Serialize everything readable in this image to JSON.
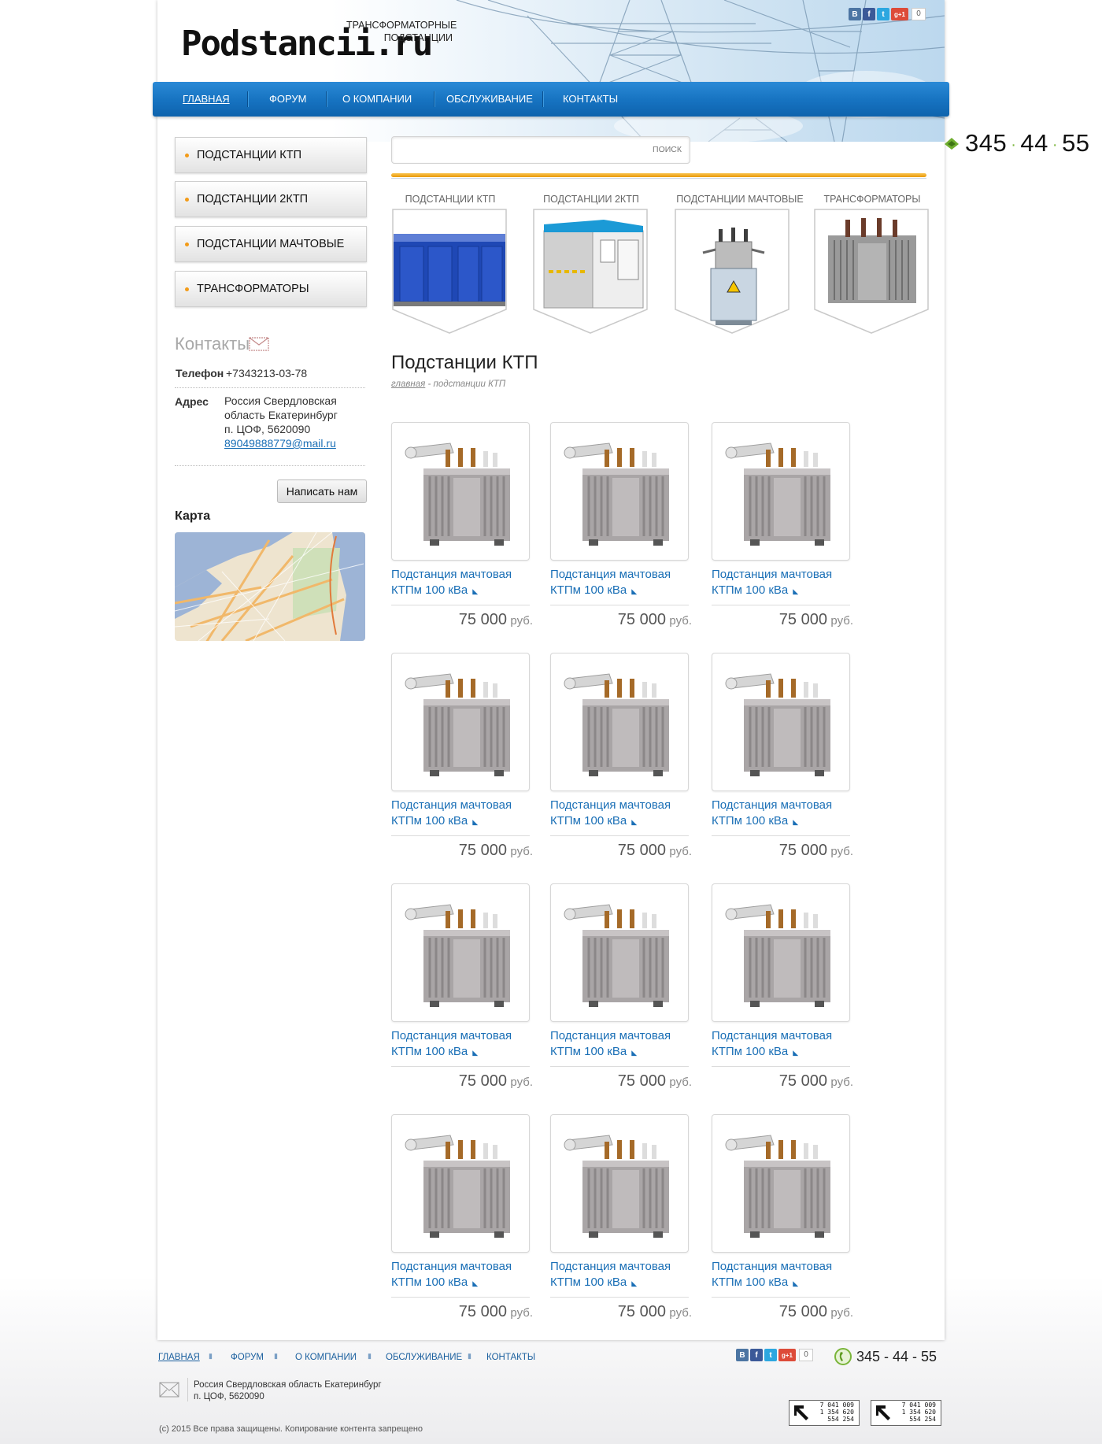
{
  "site": {
    "logo": "Podstancii.ru",
    "tagline_line1": "ТРАНСФОРМАТОРНЫЕ",
    "tagline_line2": "ПОДСТАНЦИИ"
  },
  "social": {
    "buttons": [
      {
        "icon": "vk-icon",
        "glyph": "В",
        "color": "#4c75a3"
      },
      {
        "icon": "facebook-icon",
        "glyph": "f",
        "color": "#3b5998"
      },
      {
        "icon": "twitter-icon",
        "glyph": "t",
        "color": "#2ca7e0"
      },
      {
        "icon": "google-plus-icon",
        "glyph": "g+1",
        "color": "#dd4b39"
      }
    ],
    "count": "0"
  },
  "nav": {
    "items": [
      "ГЛАВНАЯ",
      "ФОРУМ",
      "О КОМПАНИИ",
      "ОБСЛУЖИВАНИЕ",
      "КОНТАКТЫ"
    ],
    "active": "ГЛАВНАЯ"
  },
  "search": {
    "placeholder": "",
    "button": "ПОИСК"
  },
  "phone": {
    "part1": "345",
    "part2": "44",
    "part3": "55"
  },
  "sidebar": {
    "menu": [
      "ПОДСТАНЦИИ КТП",
      "ПОДСТАНЦИИ 2КТП",
      "ПОДСТАНЦИИ МАЧТОВЫЕ",
      "ТРАНСФОРМАТОРЫ"
    ],
    "contacts_title": "Контакты",
    "phone_label": "Телефон",
    "phone_value": "+7343213-03-78",
    "address_label": "Адрес",
    "address_line1": "Россия Свердловская",
    "address_line2": "область Екатеринбург",
    "address_line3": "п. ЦОФ, 5620090",
    "email": "89049888779@mail.ru",
    "write_button": "Написать нам",
    "map_title": "Карта"
  },
  "categories": [
    {
      "label": "ПОДСТАНЦИИ КТП",
      "icon": "ktp-substation-image"
    },
    {
      "label": "ПОДСТАНЦИИ 2КТП",
      "icon": "2ktp-substation-image"
    },
    {
      "label": "ПОДСТАНЦИИ МАЧТОВЫЕ",
      "icon": "mast-substation-image"
    },
    {
      "label": "ТРАНСФОРМАТОРЫ",
      "icon": "transformer-image"
    }
  ],
  "content": {
    "title": "Подстанции КТП",
    "breadcrumb_home": "главная",
    "breadcrumb_sep": " - ",
    "breadcrumb_current": "подстанции КТП"
  },
  "products": [
    {
      "name_line1": "Подстанция мачтовая",
      "name_line2": "КТПм 100 кВа",
      "price": "75 000",
      "currency": "руб."
    },
    {
      "name_line1": "Подстанция мачтовая",
      "name_line2": "КТПм 100 кВа",
      "price": "75 000",
      "currency": "руб."
    },
    {
      "name_line1": "Подстанция мачтовая",
      "name_line2": "КТПм 100 кВа",
      "price": "75 000",
      "currency": "руб."
    },
    {
      "name_line1": "Подстанция мачтовая",
      "name_line2": "КТПм 100 кВа",
      "price": "75 000",
      "currency": "руб."
    },
    {
      "name_line1": "Подстанция мачтовая",
      "name_line2": "КТПм 100 кВа",
      "price": "75 000",
      "currency": "руб."
    },
    {
      "name_line1": "Подстанция мачтовая",
      "name_line2": "КТПм 100 кВа",
      "price": "75 000",
      "currency": "руб."
    },
    {
      "name_line1": "Подстанция мачтовая",
      "name_line2": "КТПм 100 кВа",
      "price": "75 000",
      "currency": "руб."
    },
    {
      "name_line1": "Подстанция мачтовая",
      "name_line2": "КТПм 100 кВа",
      "price": "75 000",
      "currency": "руб."
    },
    {
      "name_line1": "Подстанция мачтовая",
      "name_line2": "КТПм 100 кВа",
      "price": "75 000",
      "currency": "руб."
    },
    {
      "name_line1": "Подстанция мачтовая",
      "name_line2": "КТПм 100 кВа",
      "price": "75 000",
      "currency": "руб."
    },
    {
      "name_line1": "Подстанция мачтовая",
      "name_line2": "КТПм 100 кВа",
      "price": "75 000",
      "currency": "руб."
    },
    {
      "name_line1": "Подстанция мачтовая",
      "name_line2": "КТПм 100 кВа",
      "price": "75 000",
      "currency": "руб."
    }
  ],
  "footer": {
    "nav": [
      "ГЛАВНАЯ",
      "ФОРУМ",
      "О КОМПАНИИ",
      "ОБСЛУЖИВАНИЕ",
      "КОНТАКТЫ"
    ],
    "phone": "345 - 44 - 55",
    "address_line1": "Россия Свердловская область Екатеринбург",
    "address_line2": "п. ЦОФ, 5620090",
    "copyright": "(c) 2015 Все права защищены. Копирование контента запрещено",
    "counters": [
      {
        "line1": "7 041 009",
        "line2": "1 354 620",
        "line3": "554 254"
      },
      {
        "line1": "7 041 009",
        "line2": "1 354 620",
        "line3": "554 254"
      }
    ]
  },
  "colors": {
    "nav_blue": "#1672c0",
    "accent_orange": "#f39b18",
    "link_blue": "#1a6fb6"
  }
}
